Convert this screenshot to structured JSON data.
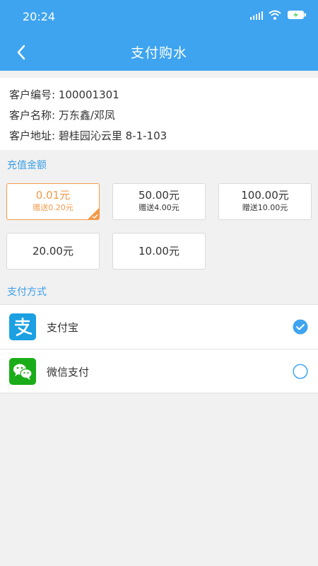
{
  "status_bar": {
    "time": "20:24"
  },
  "nav": {
    "title": "支付购水"
  },
  "customer": {
    "number_label": "客户编号:",
    "number_value": "100001301",
    "name_label": "客户名称:",
    "name_value": "万东鑫/邓凤",
    "address_label": "客户地址:",
    "address_value": "碧桂园沁云里 8-1-103"
  },
  "recharge": {
    "title": "充值金额",
    "options": [
      {
        "amount": "0.01元",
        "bonus": "赠送0.20元",
        "selected": true
      },
      {
        "amount": "50.00元",
        "bonus": "赠送4.00元",
        "selected": false
      },
      {
        "amount": "100.00元",
        "bonus": "赠送10.00元",
        "selected": false
      },
      {
        "amount": "20.00元",
        "bonus": "",
        "selected": false
      },
      {
        "amount": "10.00元",
        "bonus": "",
        "selected": false
      }
    ]
  },
  "payment": {
    "title": "支付方式",
    "methods": [
      {
        "label": "支付宝",
        "icon": "alipay-icon",
        "checked": true
      },
      {
        "label": "微信支付",
        "icon": "wechat-pay-icon",
        "checked": false
      }
    ]
  },
  "colors": {
    "header": "#3ea4ef",
    "accent_orange": "#f29a4b",
    "section_blue": "#3a9ee6",
    "alipay": "#1ba0e2",
    "wechat": "#1aad19"
  }
}
